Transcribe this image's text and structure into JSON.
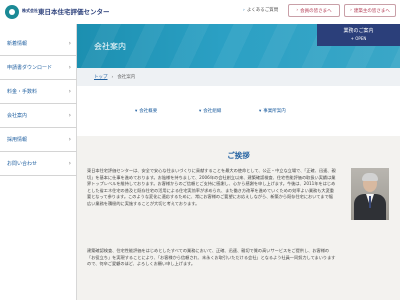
{
  "header": {
    "logo_prefix": "株式会社",
    "logo_name": "東日本住宅評価センター",
    "faq": "よくあるご質問",
    "buttons": [
      {
        "label": "会員の皆さまへ"
      },
      {
        "label": "建築主の皆さまへ"
      }
    ]
  },
  "sidebar": {
    "items": [
      {
        "label": "新着情報"
      },
      {
        "label": "申請書ダウンロード"
      },
      {
        "label": "料金・手数料"
      },
      {
        "label": "会社案内"
      },
      {
        "label": "採用情報"
      },
      {
        "label": "お問い合わせ"
      }
    ]
  },
  "banner": {
    "title": "会社案内",
    "menu_label": "業務のご案内",
    "menu_open": "+ OPEN"
  },
  "breadcrumb": {
    "home": "トップ",
    "current": "会社案内"
  },
  "anchors": [
    {
      "label": "会社概要"
    },
    {
      "label": "会社組織"
    },
    {
      "label": "事業所案内"
    }
  ],
  "greeting": {
    "title": "ご挨拶",
    "p1": "東日本住宅評価センターは、安全で安心な住まいづくりに貢献することを最大の使命として、公正・中立な立場で、「正確、迅速、親切」を基本に仕事を進めております。お陰様を持ちまして、2006年の会社創立以来、建築確認検査、住宅性能評価の取扱い実績は業界トップレベルを維持しております。お客様からのご信頼とご支持に感謝し、心から感謝を申し上げます。今後は、2011年をはじめとした省エネ住宅の普及と既存住宅の活用による住宅実効率が求められ、また働き方改革を進めていくための効率よい業務も大変重要となって参ります。このような変化に適応するために、常にお客様のご要望にお応えしながら、新築から既存住宅においてまで幅広い業務を積極的に実施することが大切と考えております。",
    "p2": "建築確認検査、住宅性能評価をはじめとしたすべての業務において、正確、迅速、親切で質の高いサービスをご提供し、お客様の「お役立ち」を実現することにより、「お客様から信頼され、末永くお取引いただける会社」となるよう社員一同努力してまいりますので、何卒ご愛顧のほど、よろしくお願い申し上げます。"
  },
  "colors": {
    "brand_navy": "#2b3f7a",
    "banner_blue": "#2ba0c4",
    "link_blue": "#1f5fa0",
    "accent_red": "#b33a53"
  }
}
